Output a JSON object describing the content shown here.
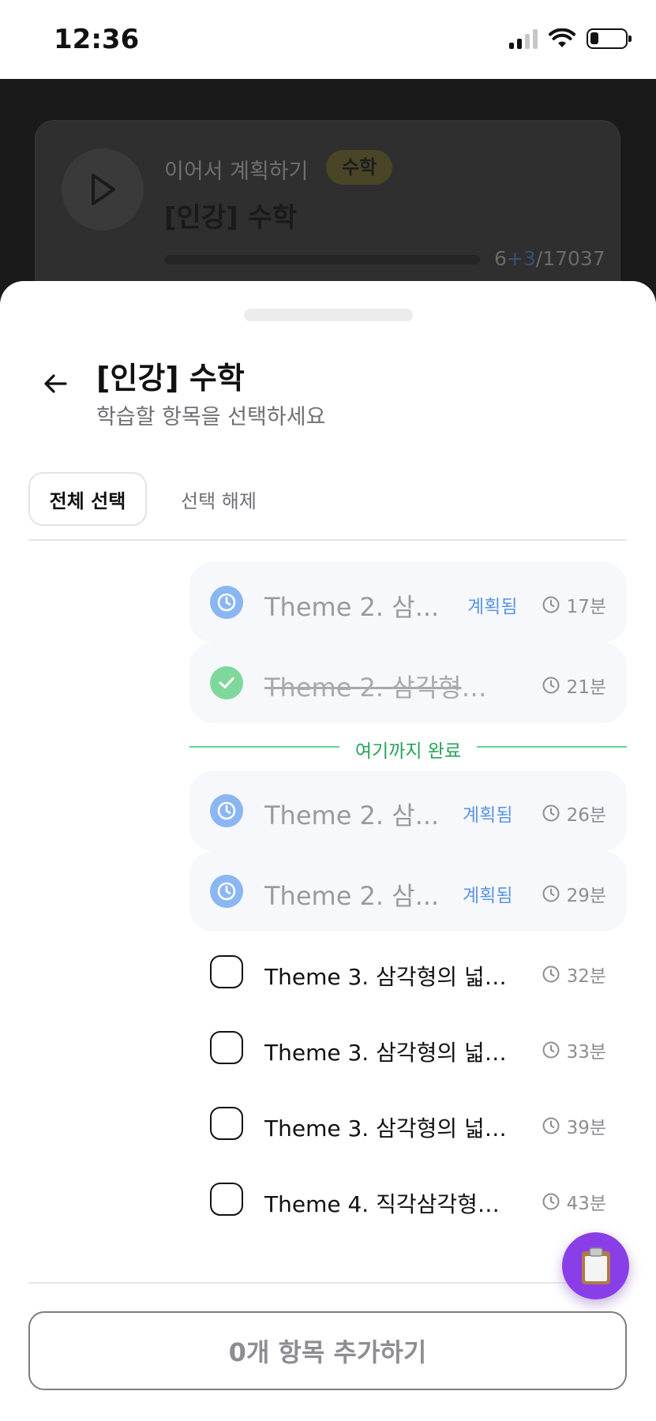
{
  "status_bar": {
    "time": "12:36"
  },
  "background_card": {
    "label": "이어서 계획하기",
    "tag": "수학",
    "title": "[인강] 수학",
    "count_done": "6",
    "count_plus": "+3",
    "count_total": "/17037"
  },
  "sheet": {
    "title": "[인강] 수학",
    "subtitle": "학습할 항목을 선택하세요",
    "select_all": "전체 선택",
    "deselect": "선택 해제",
    "completed_separator": "여기까지 완료",
    "items_before": [
      {
        "label": "Theme 2. 삼...",
        "status": "계획됨",
        "duration": "17분",
        "state": "planned"
      },
      {
        "label": "Theme 2. 삼각형의 ...",
        "status": "",
        "duration": "21분",
        "state": "completed"
      }
    ],
    "items_after": [
      {
        "label": "Theme 2. 삼...",
        "status": "계획됨",
        "duration": "26분",
        "state": "planned"
      },
      {
        "label": "Theme 2. 삼...",
        "status": "계획됨",
        "duration": "29분",
        "state": "planned"
      },
      {
        "label": "Theme 3. 삼각형의 넓이...",
        "duration": "32분",
        "state": "unselected"
      },
      {
        "label": "Theme 3. 삼각형의 넓이...",
        "duration": "33분",
        "state": "unselected"
      },
      {
        "label": "Theme 3. 삼각형의 넓이...",
        "duration": "39분",
        "state": "unselected"
      },
      {
        "label": "Theme 4. 직각삼각형과 ...",
        "duration": "43분",
        "state": "unselected"
      }
    ],
    "add_button": "0개 항목 추가하기",
    "fab_icon": "clipboard-icon"
  },
  "colors": {
    "accent": "#8a3ee8",
    "planned": "#5b95e6",
    "done": "#26a35a"
  }
}
